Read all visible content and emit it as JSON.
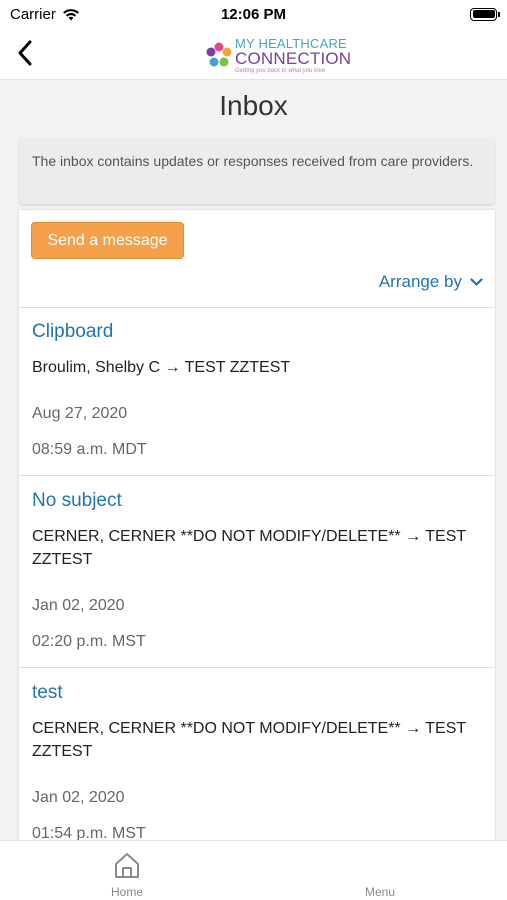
{
  "status": {
    "carrier": "Carrier",
    "time": "12:06 PM"
  },
  "header": {
    "logo_line1": "MY HEALTHCARE",
    "logo_line2": "CONNECTION",
    "logo_tagline": "Getting you back to what you love"
  },
  "page": {
    "title": "Inbox",
    "info": "The inbox contains updates or responses received from care providers."
  },
  "toolbar": {
    "send_label": "Send a message",
    "arrange_label": "Arrange by"
  },
  "messages": [
    {
      "subject": "Clipboard",
      "from": "Broulim, Shelby C → TEST ZZTEST",
      "date": "Aug 27, 2020",
      "time": "08:59 a.m. MDT"
    },
    {
      "subject": "No subject",
      "from": "CERNER, CERNER **DO NOT MODIFY/DELETE** → TEST ZZTEST",
      "date": "Jan 02, 2020",
      "time": "02:20 p.m. MST"
    },
    {
      "subject": "test",
      "from": "CERNER, CERNER **DO NOT MODIFY/DELETE** → TEST ZZTEST",
      "date": "Jan 02, 2020",
      "time": "01:54 p.m. MST"
    }
  ],
  "tabs": {
    "home": "Home",
    "menu": "Menu"
  },
  "colors": {
    "accent": "#1f74b4",
    "button": "#f5a04a"
  }
}
